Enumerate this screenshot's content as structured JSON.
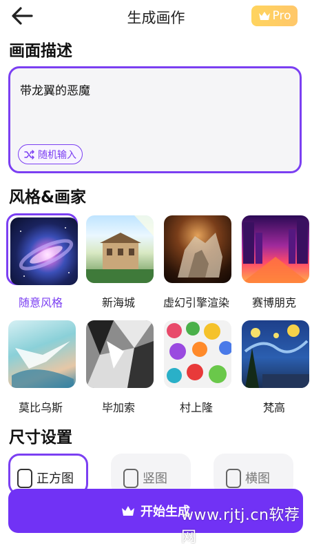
{
  "header": {
    "title": "生成画作",
    "pro_label": "Pro"
  },
  "description": {
    "section_title": "画面描述",
    "prompt_text": "带龙翼的恶魔",
    "random_label": "随机输入"
  },
  "styles": {
    "section_title": "风格&画家",
    "items": [
      {
        "label": "随意风格",
        "selected": true
      },
      {
        "label": "新海城",
        "selected": false
      },
      {
        "label": "虚幻引擎渲染",
        "selected": false
      },
      {
        "label": "赛博朋克",
        "selected": false
      },
      {
        "label": "莫比乌斯",
        "selected": false
      },
      {
        "label": "毕加索",
        "selected": false
      },
      {
        "label": "村上隆",
        "selected": false
      },
      {
        "label": "梵高",
        "selected": false
      }
    ]
  },
  "size": {
    "section_title": "尺寸设置",
    "options": [
      {
        "label": "正方图",
        "selected": true
      },
      {
        "label": "竖图",
        "selected": false
      },
      {
        "label": "横图",
        "selected": false
      }
    ]
  },
  "generate": {
    "label": "开始生成"
  },
  "watermark": "www.rjtj.cn软荐网",
  "colors": {
    "accent": "#7b3ff2",
    "button": "#7132f5",
    "pro": "#ffc86a"
  }
}
